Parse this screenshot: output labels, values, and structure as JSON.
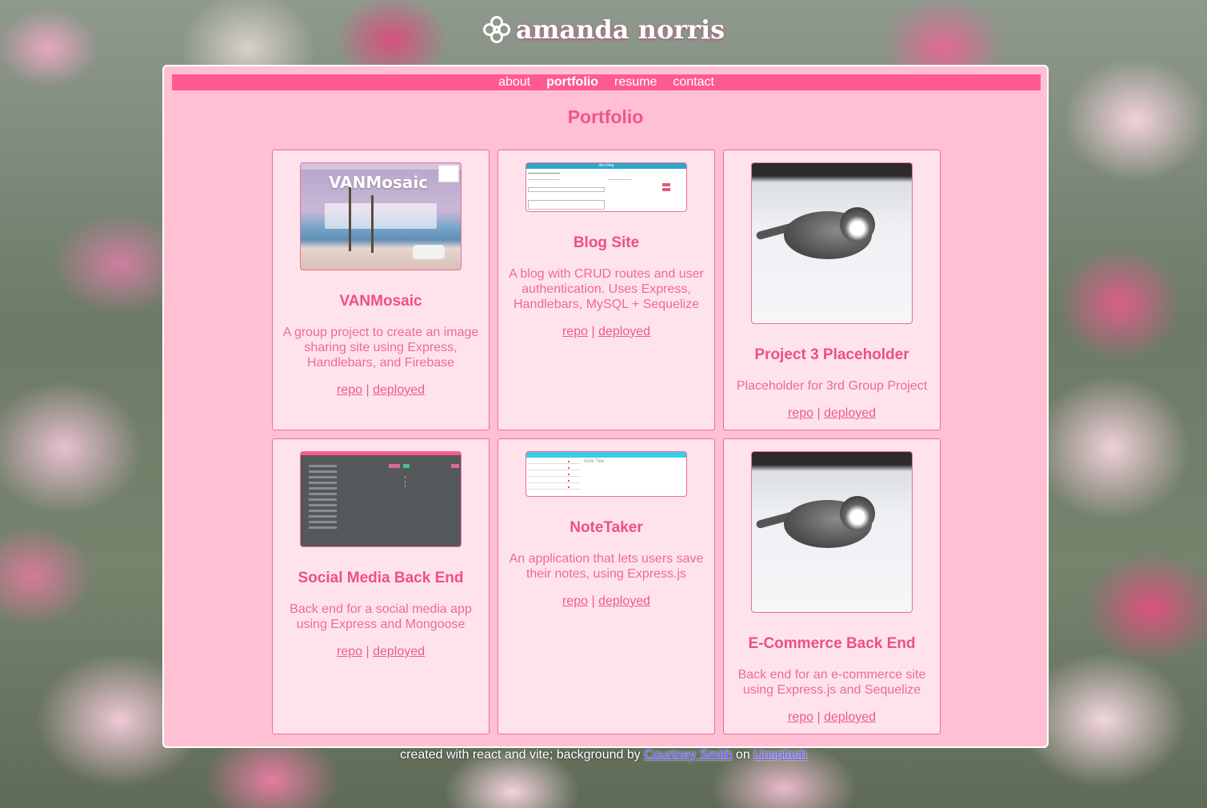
{
  "site": {
    "name": "amanda norris",
    "logo_icon": "flower-icon"
  },
  "nav": {
    "items": [
      {
        "label": "about"
      },
      {
        "label": "portfolio",
        "active": true
      },
      {
        "label": "resume"
      },
      {
        "label": "contact"
      }
    ]
  },
  "page": {
    "title": "Portfolio"
  },
  "projects": [
    {
      "title": "VANMosaic",
      "description": "A group project to create an image sharing site using Express, Handlebars, and Firebase",
      "thumb_text": "VANMosaic",
      "repo_label": "repo",
      "deployed_label": "deployed"
    },
    {
      "title": "Blog Site",
      "description": "A blog with CRUD routes and user authentication. Uses Express, Handlebars, MySQL + Sequelize",
      "thumb_text": "dev blog",
      "repo_label": "repo",
      "deployed_label": "deployed"
    },
    {
      "title": "Project 3 Placeholder",
      "description": "Placeholder for 3rd Group Project",
      "repo_label": "repo",
      "deployed_label": "deployed"
    },
    {
      "title": "Social Media Back End",
      "description": "Back end for a social media app using Express and Mongoose",
      "repo_label": "repo",
      "deployed_label": "deployed"
    },
    {
      "title": "NoteTaker",
      "description": "An application that lets users save their notes, using Express.js",
      "thumb_text": "Note Title",
      "repo_label": "repo",
      "deployed_label": "deployed"
    },
    {
      "title": "E-Commerce Back End",
      "description": "Back end for an e-commerce site using Express.js and Sequelize",
      "repo_label": "repo",
      "deployed_label": "deployed"
    }
  ],
  "links": {
    "separator": "|"
  },
  "footer": {
    "prefix": "created with react and vite; background by",
    "author": "Courtney Smith",
    "on": "on",
    "source": "Unsplash"
  },
  "colors": {
    "nav_bar": "#ff5a8f",
    "panel": "#ffc0d3",
    "card": "#ffe3ec",
    "accent": "#ee4f87"
  }
}
